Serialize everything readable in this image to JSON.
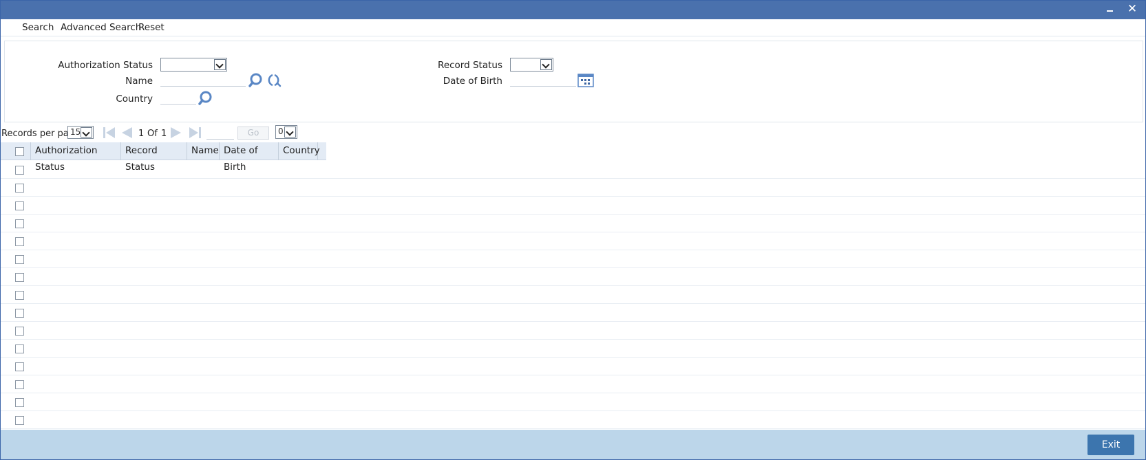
{
  "window": {
    "minimize_icon": "minimize-icon",
    "close_icon": "close-icon",
    "close_glyph": "✕"
  },
  "menu": {
    "search": "Search",
    "advanced_search": "Advanced Search",
    "reset": "Reset"
  },
  "criteria": {
    "authorization_status_label": "Authorization Status",
    "authorization_status_value": "",
    "record_status_label": "Record Status",
    "record_status_value": "",
    "name_label": "Name",
    "name_value": "",
    "date_of_birth_label": "Date of Birth",
    "date_of_birth_value": "",
    "country_label": "Country",
    "country_value": ""
  },
  "pager": {
    "records_per_page_label": "Records per page",
    "records_per_page_value": "15",
    "current_page": "1",
    "of_label": "Of",
    "total_pages": "1",
    "go_label": "Go",
    "page_select_value": "0"
  },
  "grid": {
    "columns": [
      "Authorization Status",
      "Record Status",
      "Name",
      "Date of Birth",
      "Country"
    ],
    "row_count": 15
  },
  "footer": {
    "exit_label": "Exit"
  },
  "colors": {
    "titlebar": "#4a71ad",
    "header": "#e3ebf5",
    "footer": "#bcd6ea",
    "exit_button": "#3c75ae",
    "icon_blue": "#5a87c5"
  }
}
